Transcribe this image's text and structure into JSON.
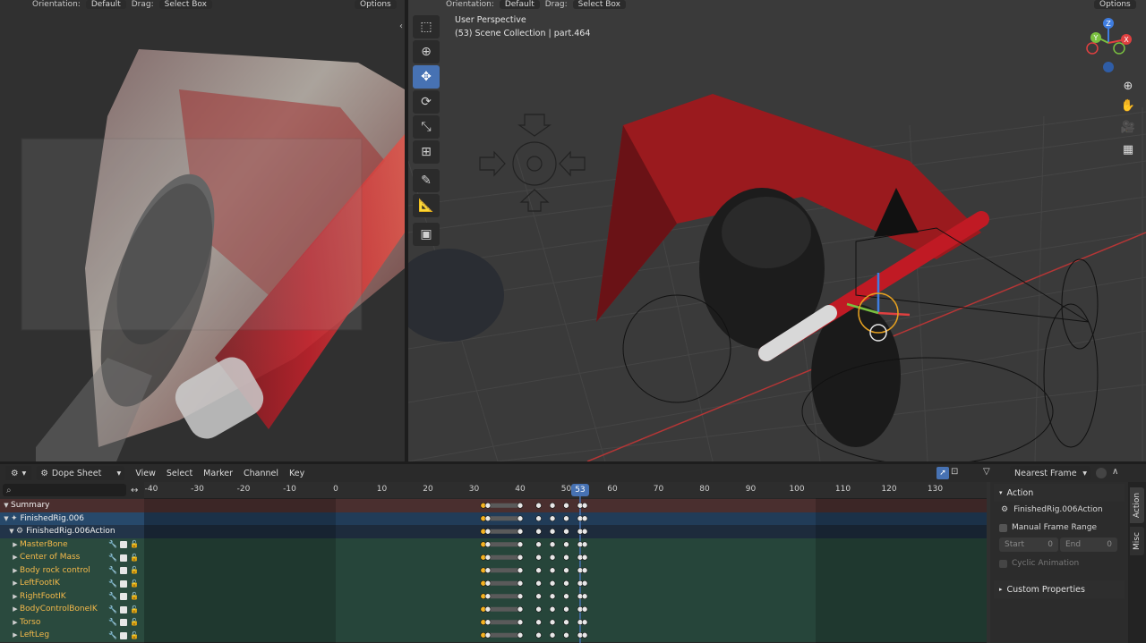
{
  "left_viewport": {
    "header": {
      "orientation_label": "Orientation:",
      "orientation_value": "Default",
      "drag_label": "Drag:",
      "drag_value": "Select Box",
      "options_label": "Options"
    }
  },
  "right_viewport": {
    "header": {
      "orientation_label": "Orientation:",
      "orientation_value": "Default",
      "drag_label": "Drag:",
      "drag_value": "Select Box",
      "options_label": "Options"
    },
    "info_line1": "User Perspective",
    "info_line2": "(53) Scene Collection | part.464",
    "gizmo": {
      "z_label": "Z",
      "y_label": "Y",
      "x_label": "X"
    },
    "tools": [
      "select-box",
      "cursor",
      "move",
      "rotate",
      "scale",
      "transform",
      "annotate",
      "measure",
      "add-cube"
    ],
    "nav": [
      "zoom-icon",
      "hand-icon",
      "camera-icon",
      "grid-icon"
    ]
  },
  "dopesheet": {
    "editor_type": "Dope Sheet",
    "menus": [
      "View",
      "Select",
      "Marker",
      "Channel",
      "Key"
    ],
    "snapping": "Nearest Frame",
    "ruler_ticks": [
      -40,
      -30,
      -20,
      -10,
      0,
      10,
      20,
      30,
      40,
      50,
      60,
      70,
      80,
      90,
      100,
      110,
      120,
      130
    ],
    "current_frame": 53,
    "channels": [
      {
        "label": "Summary",
        "kind": "summary"
      },
      {
        "label": "FinishedRig.006",
        "kind": "object"
      },
      {
        "label": "FinishedRig.006Action",
        "kind": "action"
      },
      {
        "label": "MasterBone",
        "kind": "bone"
      },
      {
        "label": "Center of Mass",
        "kind": "bone"
      },
      {
        "label": "Body rock control",
        "kind": "bone"
      },
      {
        "label": "LeftFootIK",
        "kind": "bone"
      },
      {
        "label": "RightFootIK",
        "kind": "bone"
      },
      {
        "label": "BodyControlBoneIK",
        "kind": "bone"
      },
      {
        "label": "Torso",
        "kind": "bone"
      },
      {
        "label": "LeftLeg",
        "kind": "bone"
      }
    ],
    "keyframes": [
      32,
      33,
      40,
      44,
      47,
      50,
      53,
      54
    ],
    "sidebar": {
      "action_header": "Action",
      "action_name": "FinishedRig.006Action",
      "manual_range_label": "Manual Frame Range",
      "start_label": "Start",
      "start_value": "0",
      "end_label": "End",
      "end_value": "0",
      "cyclic_label": "Cyclic Animation",
      "custom_props_header": "Custom Properties",
      "tabs": [
        "Action",
        "Misc"
      ]
    }
  }
}
